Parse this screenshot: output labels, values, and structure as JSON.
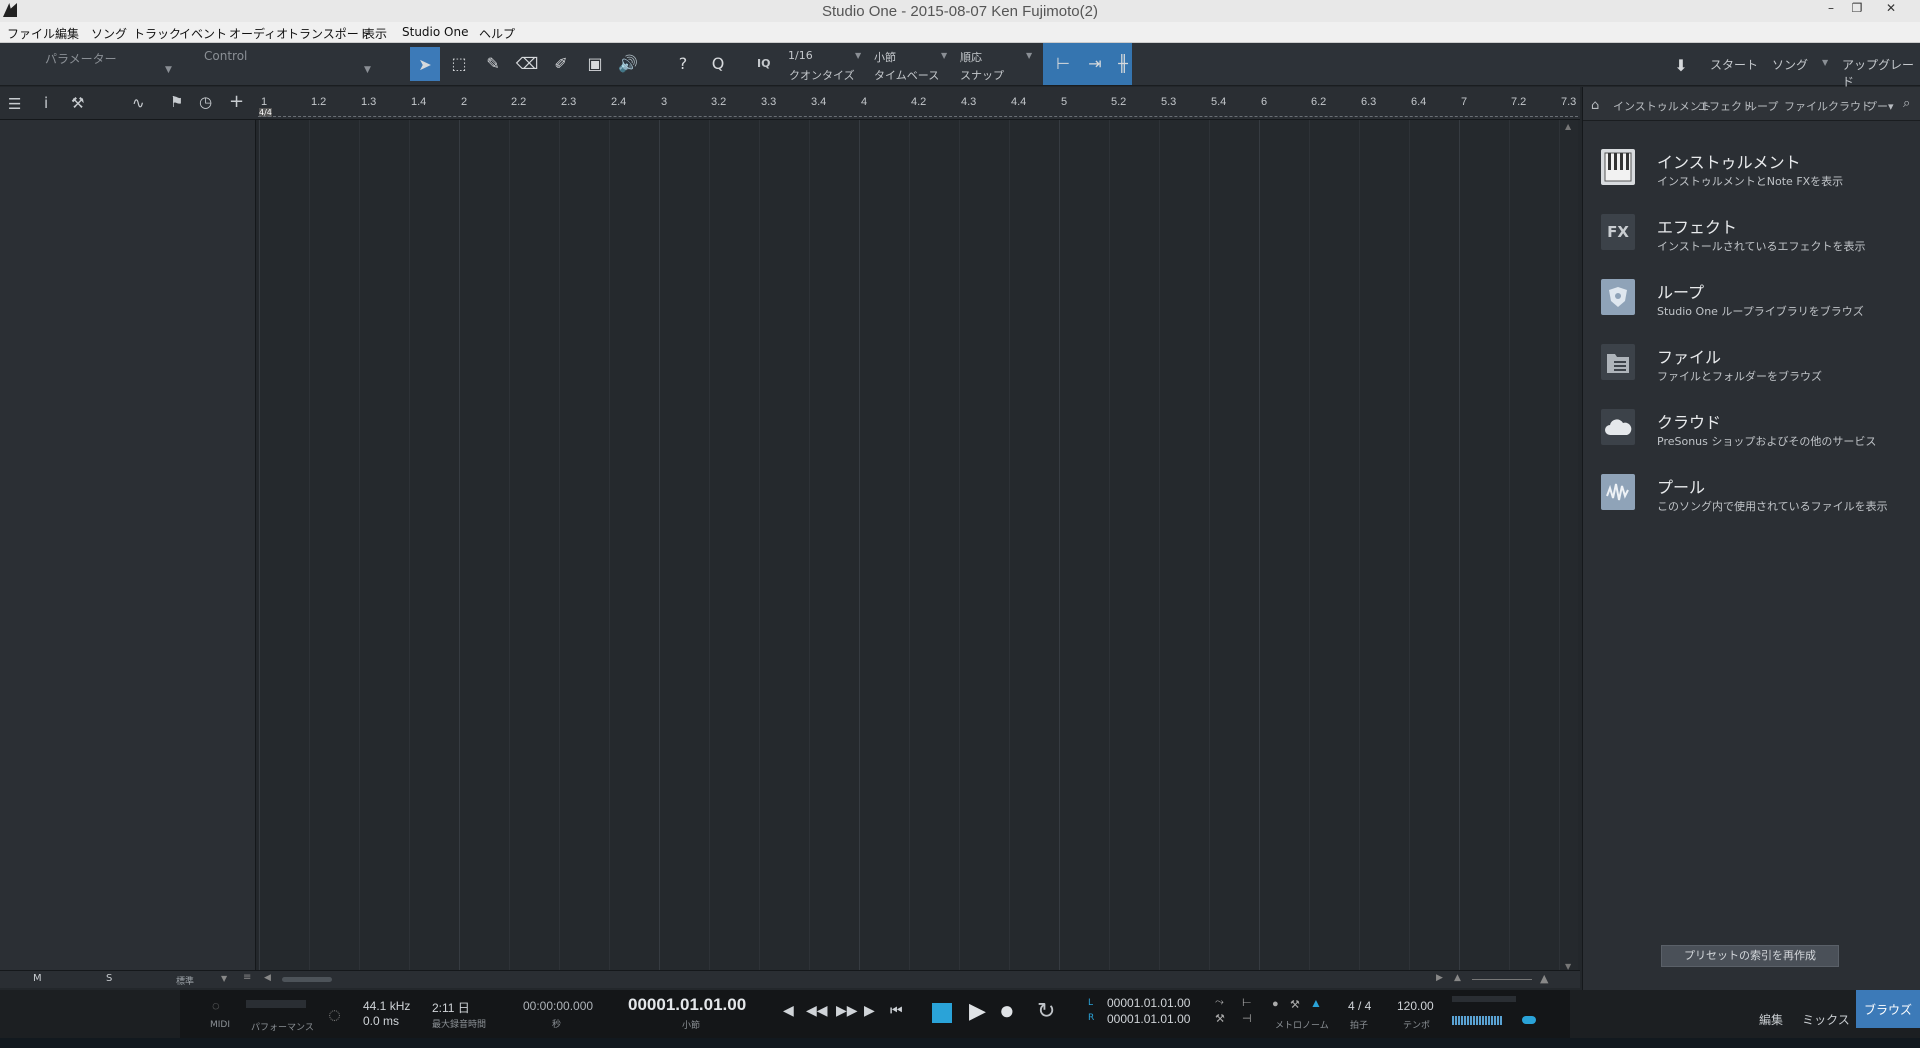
{
  "window": {
    "title": "Studio One - 2015-08-07 Ken Fujimoto(2)",
    "controls": [
      "–",
      "❐",
      "✕"
    ]
  },
  "menu": [
    "ファイル",
    "編集",
    "ソング",
    "トラック",
    "イベント",
    "オーディオ",
    "トランスポート",
    "表示",
    "Studio One",
    "ヘルプ"
  ],
  "toolbar": {
    "param_label": "パラメーター",
    "control_label": "Control",
    "quantize_value": "1/16",
    "quantize_label": "クオンタイズ",
    "timebase_value": "小節",
    "timebase_label": "タイムベース",
    "snap_value": "順応",
    "snap_label": "スナップ",
    "iq": "IQ",
    "start": "スタート",
    "song": "ソング",
    "upgrade": "アップグレード"
  },
  "ruler": {
    "time_signature": "4/4",
    "labels": [
      "1",
      "1.2",
      "1.3",
      "1.4",
      "2",
      "2.2",
      "2.3",
      "2.4",
      "3",
      "3.2",
      "3.3",
      "3.4",
      "4",
      "4.2",
      "4.3",
      "4.4",
      "5",
      "5.2",
      "5.3",
      "5.4",
      "6",
      "6.2",
      "6.3",
      "6.4",
      "7",
      "7.2",
      "7.3"
    ]
  },
  "bottom_left": {
    "m": "M",
    "s": "S",
    "mode": "標準"
  },
  "browser": {
    "tabs": [
      "インストゥルメント",
      "エフェクト",
      "ループ",
      "ファイル",
      "クラウド",
      "プー▾"
    ],
    "items": [
      {
        "title": "インストゥルメント",
        "subtitle": "インストゥルメントとNote FXを表示",
        "icon": "piano-icon"
      },
      {
        "title": "エフェクト",
        "subtitle": "インストールされているエフェクトを表示",
        "icon": "fx-icon"
      },
      {
        "title": "ループ",
        "subtitle": "Studio One ループライブラリをブラウズ",
        "icon": "loop-icon"
      },
      {
        "title": "ファイル",
        "subtitle": "ファイルとフォルダーをブラウズ",
        "icon": "file-icon"
      },
      {
        "title": "クラウド",
        "subtitle": "PreSonus ショップおよびその他のサービス",
        "icon": "cloud-icon"
      },
      {
        "title": "プール",
        "subtitle": "このソング内で使用されているファイルを表示",
        "icon": "pool-icon"
      }
    ],
    "fx_text": "FX",
    "rebuild_button": "プリセットの索引を再作成"
  },
  "transport": {
    "midi": "MIDI",
    "performance": "パフォーマンス",
    "sample_rate": "44.1 kHz",
    "latency": "0.0 ms",
    "record_time": "2:11 日",
    "record_time_label": "最大録音時間",
    "seconds": "00:00:00.000",
    "seconds_label": "秒",
    "position": "00001.01.01.00",
    "position_label": "小節",
    "loop_l_label": "L",
    "loop_r_label": "R",
    "loop_l": "00001.01.01.00",
    "loop_r": "00001.01.01.00",
    "metronome_label": "メトロノーム",
    "time_sig": "4 / 4",
    "time_sig_label": "拍子",
    "tempo": "120.00",
    "tempo_label": "テンポ"
  },
  "pages": {
    "edit": "編集",
    "mix": "ミックス",
    "browse": "ブラウズ"
  },
  "colors": {
    "accent": "#3c7ab8",
    "transport_blue": "#2aa3d8"
  }
}
